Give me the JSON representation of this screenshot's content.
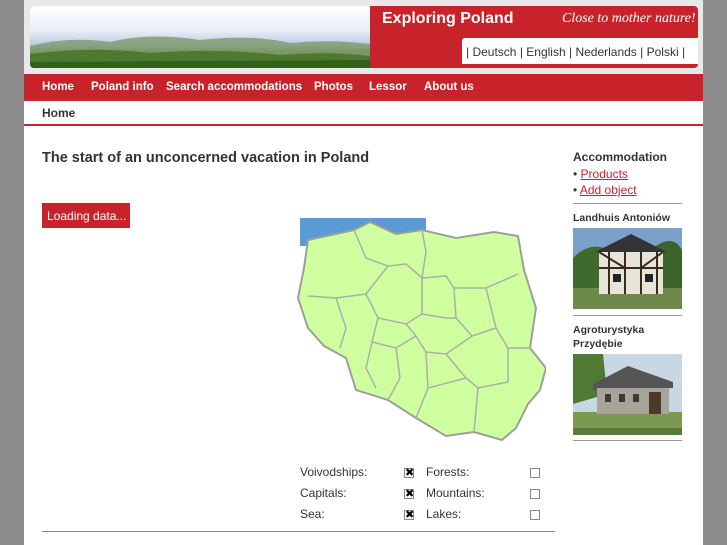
{
  "header": {
    "site_title": "Exploring Poland",
    "tagline": "Close to mother nature!",
    "languages": [
      "Deutsch",
      "English",
      "Nederlands",
      "Polski"
    ]
  },
  "nav": {
    "items": [
      "Home",
      "Poland info",
      "Search accommodations",
      "Photos",
      "Lessor",
      "About us"
    ]
  },
  "breadcrumb": "Home",
  "main": {
    "heading": "The start of an unconcerned vacation in Poland",
    "loading_label": "Loading data...",
    "map_legend": [
      {
        "label": "Voivodships:",
        "checked": true
      },
      {
        "label": "Forests:",
        "checked": false
      },
      {
        "label": "Capitals:",
        "checked": true
      },
      {
        "label": "Mountains:",
        "checked": false
      },
      {
        "label": "Sea:",
        "checked": true
      },
      {
        "label": "Lakes:",
        "checked": false
      }
    ]
  },
  "sidebar": {
    "title": "Accommodation",
    "links": [
      "Products",
      "Add object"
    ],
    "objects": [
      {
        "name": "Landhuis Antoniów"
      },
      {
        "name": "Agroturystyka Przydębie"
      }
    ]
  },
  "colors": {
    "brand_red": "#c8232a",
    "map_fill": "#cfff9f",
    "sea": "#5b9bd5"
  }
}
